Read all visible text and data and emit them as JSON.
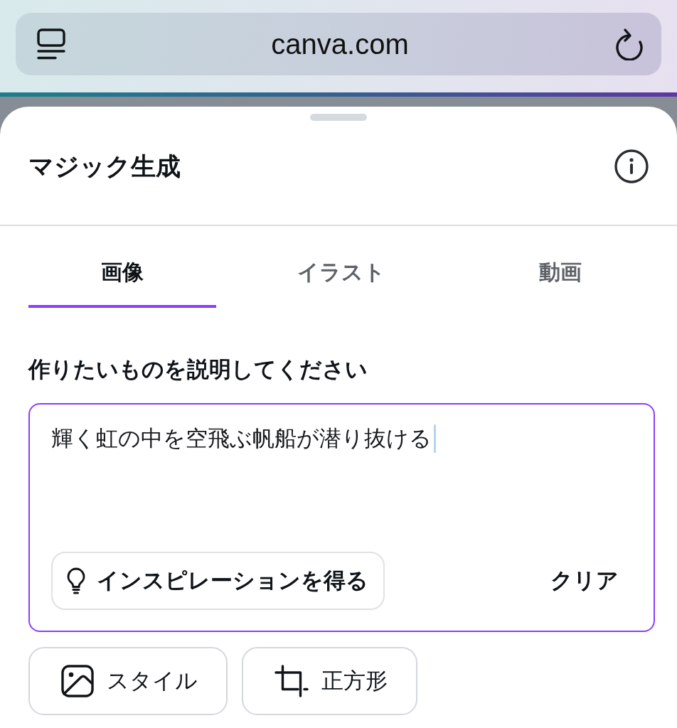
{
  "browser": {
    "url": "canva.com"
  },
  "panel": {
    "title": "マジック生成"
  },
  "tabs": [
    {
      "label": "画像",
      "selected": true
    },
    {
      "label": "イラスト",
      "selected": false
    },
    {
      "label": "動画",
      "selected": false
    }
  ],
  "prompt": {
    "label": "作りたいものを説明してください",
    "value": "輝く虹の中を空飛ぶ帆船が潜り抜ける",
    "focused": true,
    "inspiration_button": "インスピレーションを得る",
    "clear_button": "クリア"
  },
  "options": [
    {
      "kind": "style",
      "label": "スタイル"
    },
    {
      "kind": "aspect",
      "label": "正方形"
    }
  ]
}
